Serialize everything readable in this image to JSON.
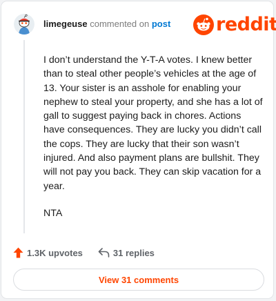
{
  "brand": {
    "logo_text": "reddit",
    "accent": "#ff4500",
    "link_color": "#0079d3"
  },
  "comment": {
    "username": "limegeuse",
    "action_text": "commented on",
    "post_link": "post",
    "avatar_icon": "snoo-avatar-icon",
    "paragraphs": [
      "I don’t understand the Y-T-A votes. I knew better than to steal other people’s vehicles at the age of 13. Your sister is an asshole for enabling your nephew to steal your property, and she has a lot of gall to suggest paying back in chores. Actions have consequences. They are lucky you didn’t call the cops. They are lucky that their son wasn’t injured. And also payment plans are bullshit. They will not pay you back. They can skip vacation for a year.",
      "NTA"
    ]
  },
  "actions": {
    "upvotes": "1.3K upvotes",
    "upvote_icon": "upvote-arrow-icon",
    "replies": "31 replies",
    "reply_icon": "reply-arrow-icon"
  },
  "footer": {
    "view_comments": "View 31 comments"
  }
}
